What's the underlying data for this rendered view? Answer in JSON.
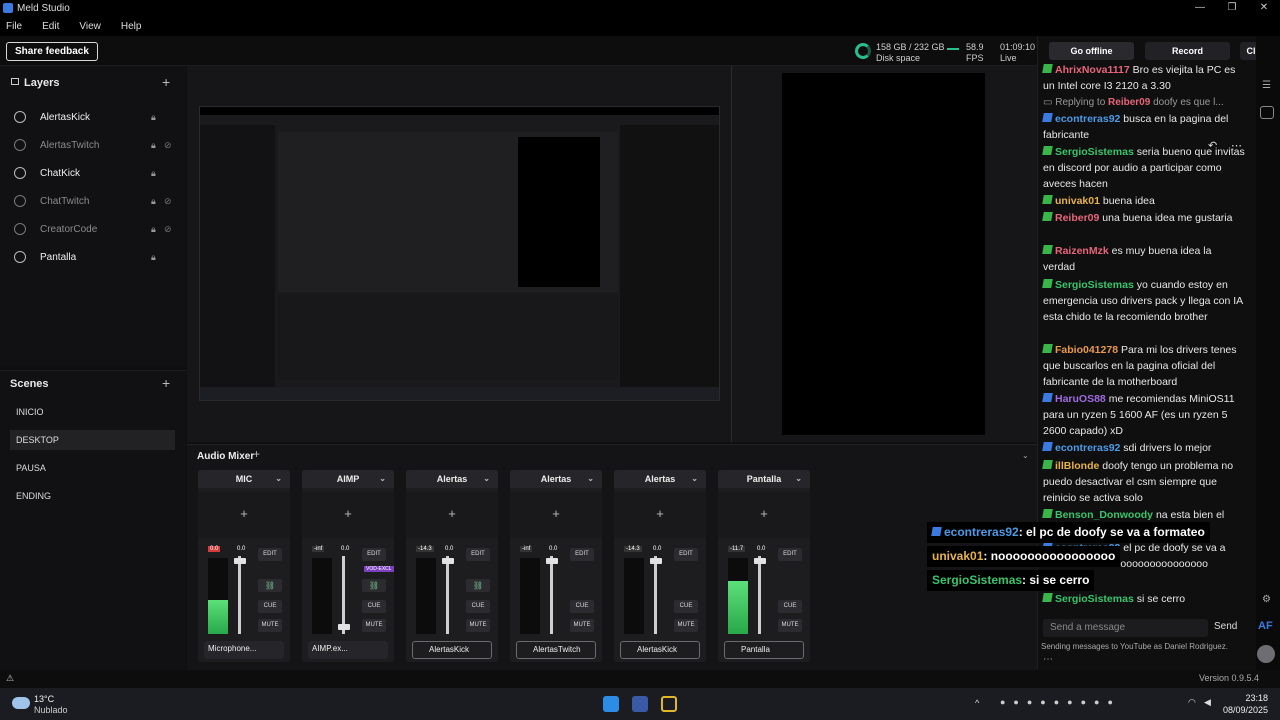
{
  "window": {
    "title": "Meld Studio",
    "minimize": "—",
    "maximize": "❐",
    "close": "✕"
  },
  "menu": [
    "File",
    "Edit",
    "View",
    "Help"
  ],
  "toolbar": {
    "feedback": "Share feedback",
    "disk_value": "158 GB / 232 GB",
    "disk_label": "Disk space",
    "fps_value": "58.9",
    "fps_label": "FPS",
    "live_time": "01:09:10",
    "live_label": "Live",
    "go_offline": "Go offline",
    "record": "Record",
    "clip": "Clip"
  },
  "layers": {
    "title": "Layers",
    "items": [
      {
        "name": "AlertasKick",
        "dim": false
      },
      {
        "name": "AlertasTwitch",
        "dim": true
      },
      {
        "name": "ChatKick",
        "dim": false
      },
      {
        "name": "ChatTwitch",
        "dim": true
      },
      {
        "name": "CreatorCode",
        "dim": true
      },
      {
        "name": "Pantalla",
        "dim": false
      }
    ]
  },
  "scenes": {
    "title": "Scenes",
    "items": [
      "INICIO",
      "DESKTOP",
      "PAUSA",
      "ENDING"
    ],
    "active": "DESKTOP"
  },
  "mixer": {
    "title": "Audio Mixer",
    "channels": [
      {
        "name": "MIC",
        "db": "0.0",
        "vol": "0.0",
        "source": "Microphone...",
        "edit": "EDIT",
        "cue": "CUE",
        "mute": "MUTE",
        "level": 0.45
      },
      {
        "name": "AIMP",
        "db": "-inf",
        "vol": "0.0",
        "source": "AIMP.ex...",
        "edit": "EDIT",
        "cue": "CUE",
        "mute": "MUTE",
        "level": 0.0,
        "tag": "VOD-EXCL"
      },
      {
        "name": "Alertas",
        "db": "-14.3",
        "vol": "0.0",
        "source": "AlertasKick",
        "edit": "EDIT",
        "cue": "CUE",
        "mute": "MUTE",
        "level": 0.0
      },
      {
        "name": "Alertas",
        "db": "-inf",
        "vol": "0.0",
        "source": "AlertasTwitch",
        "edit": "EDIT",
        "cue": "CUE",
        "mute": "MUTE",
        "level": 0.0
      },
      {
        "name": "Alertas",
        "db": "-14.3",
        "vol": "0.0",
        "source": "AlertasKick",
        "edit": "EDIT",
        "cue": "CUE",
        "mute": "MUTE",
        "level": 0.0
      },
      {
        "name": "Pantalla",
        "db": "-11.7",
        "vol": "0.0",
        "source": "Pantalla",
        "edit": "EDIT",
        "cue": "CUE",
        "mute": "MUTE",
        "level": 0.7
      }
    ]
  },
  "chat": {
    "messages": [
      {
        "user": "AhrixNova1117",
        "color": "#e7657b",
        "badge": "green",
        "text": "Bro es viejita la PC es un Intel core I3 2120 a 3.30"
      },
      {
        "user": "Reiber09",
        "color": "#e7657b",
        "badge": "reply",
        "prefix": "Replying to",
        "text": "doofy es que l..."
      },
      {
        "user": "econtreras92",
        "color": "#4c9be8",
        "badge": "blue",
        "text": "busca en la pagina del fabricante"
      },
      {
        "user": "SergioSistemas",
        "color": "#39c46b",
        "badge": "green",
        "text": "seria bueno que invitas en discord por audio a participar como aveces hacen"
      },
      {
        "user": "univak01",
        "color": "#e7b34a",
        "badge": "green",
        "text": "buena idea"
      },
      {
        "user": "Reiber09",
        "color": "#e7657b",
        "badge": "green",
        "text": "una buena idea me gustaria"
      },
      {
        "user": "RaizenMzk",
        "color": "#e7657b",
        "badge": "green",
        "text": "es muy buena idea la verdad"
      },
      {
        "user": "SergioSistemas",
        "color": "#39c46b",
        "badge": "green",
        "text": "yo cuando estoy en emergencia uso drivers pack y llega con IA esta chido te la recomiendo brother"
      },
      {
        "user": "Fabio041278",
        "color": "#e79a4a",
        "badge": "green",
        "text": "Para mi los drivers tenes que buscarlos en la pagina oficial del fabricante de la motherboard"
      },
      {
        "user": "HaruOS88",
        "color": "#a06be0",
        "badge": "blue",
        "text": "me recomiendas MiniOS11 para un ryzen 5 1600 AF (es un ryzen 5 2600 capado) xD"
      },
      {
        "user": "econtreras92",
        "color": "#4c9be8",
        "badge": "blue",
        "text": "sdi drivers lo mejor"
      },
      {
        "user": "illBlonde",
        "color": "#e7b34a",
        "badge": "green",
        "text": "doofy tengo un problema no puedo desactivar el csm siempre que reinicio se activa solo"
      },
      {
        "user": "Benson_Donwoody",
        "color": "#39c46b",
        "badge": "green",
        "text": "na esta bien el"
      },
      {
        "user": "econtreras92",
        "color": "#4c9be8",
        "badge": "blue",
        "text": "el pc de doofy se va a formateo"
      },
      {
        "user": "univak01",
        "color": "#e7b34a",
        "badge": "green",
        "text": "nooooooooooooooooo"
      },
      {
        "user": "SergioSistemas",
        "color": "#39c46b",
        "badge": "green",
        "text": "si se cerro"
      }
    ],
    "input_placeholder": "Send a message",
    "send": "Send",
    "sending_note": "Sending messages to YouTube as Daniel Rodriguez.",
    "version": "Version 0.9.5.4"
  },
  "overlay": [
    {
      "user": "econtreras92",
      "color": "#4c9be8",
      "text": ": el pc de doofy se va a formateo"
    },
    {
      "user": "univak01",
      "color": "#e7b34a",
      "text": ": noooooooooooooooo"
    },
    {
      "user": "SergioSistemas",
      "color": "#39c46b",
      "text": ": si se cerro"
    }
  ],
  "taskbar": {
    "temp": "13°C",
    "weather": "Nublado",
    "time": "23:18",
    "date": "08/09/2025"
  }
}
